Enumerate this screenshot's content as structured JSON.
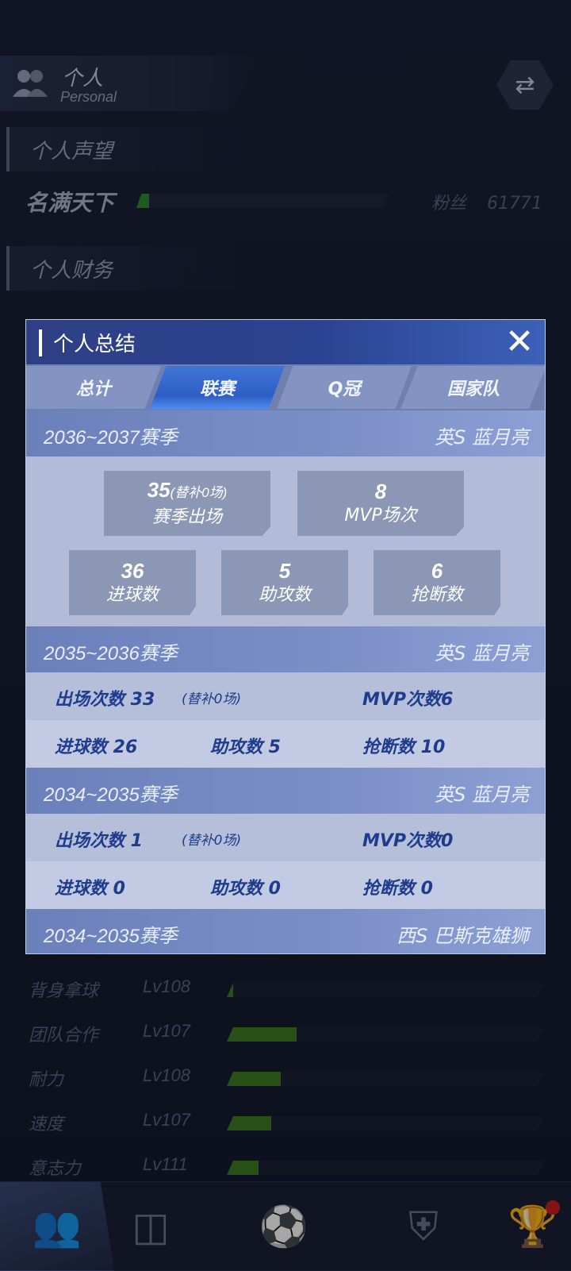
{
  "header": {
    "title": "个人",
    "subtitle": "Personal"
  },
  "reputation": {
    "section_title": "个人声望",
    "name": "名满天下",
    "fans_label": "粉丝",
    "fans_value": "61771",
    "progress": 0.05
  },
  "finance": {
    "section_title": "个人财务"
  },
  "attributes": [
    {
      "name": "背身拿球",
      "level": "Lv108",
      "progress": 0.02
    },
    {
      "name": "团队合作",
      "level": "Lv107",
      "progress": 0.22
    },
    {
      "name": "耐力",
      "level": "Lv108",
      "progress": 0.17
    },
    {
      "name": "速度",
      "level": "Lv107",
      "progress": 0.14
    },
    {
      "name": "意志力",
      "level": "Lv111",
      "progress": 0.1
    }
  ],
  "modal": {
    "title": "个人总结",
    "tabs": [
      "总计",
      "联赛",
      "Q冠",
      "国家队"
    ],
    "active_tab": 1,
    "current_season": {
      "season": "2036~2037赛季",
      "club": "英S 蓝月亮",
      "appearances": "35",
      "appearances_sub": "(替补0场)",
      "appearances_label": "赛季出场",
      "mvp": "8",
      "mvp_label": "MVP场次",
      "goals": "36",
      "goals_label": "进球数",
      "assists": "5",
      "assists_label": "助攻数",
      "tackles": "6",
      "tackles_label": "抢断数"
    },
    "seasons": [
      {
        "season": "2035~2036赛季",
        "club": "英S 蓝月亮",
        "appear": "出场次数 33",
        "sub": "(替补0场)",
        "mvp": "MVP次数6",
        "goals": "进球数 26",
        "assists": "助攻数 5",
        "tackles": "抢断数 10"
      },
      {
        "season": "2034~2035赛季",
        "club": "英S 蓝月亮",
        "appear": "出场次数 1",
        "sub": "(替补0场)",
        "mvp": "MVP次数0",
        "goals": "进球数 0",
        "assists": "助攻数 0",
        "tackles": "抢断数 0"
      },
      {
        "season": "2034~2035赛季",
        "club": "西S 巴斯克雄狮"
      }
    ]
  },
  "nav": [
    "person-icon",
    "pitch-icon",
    "football-icon",
    "club-badge-icon",
    "trophy-icon"
  ]
}
